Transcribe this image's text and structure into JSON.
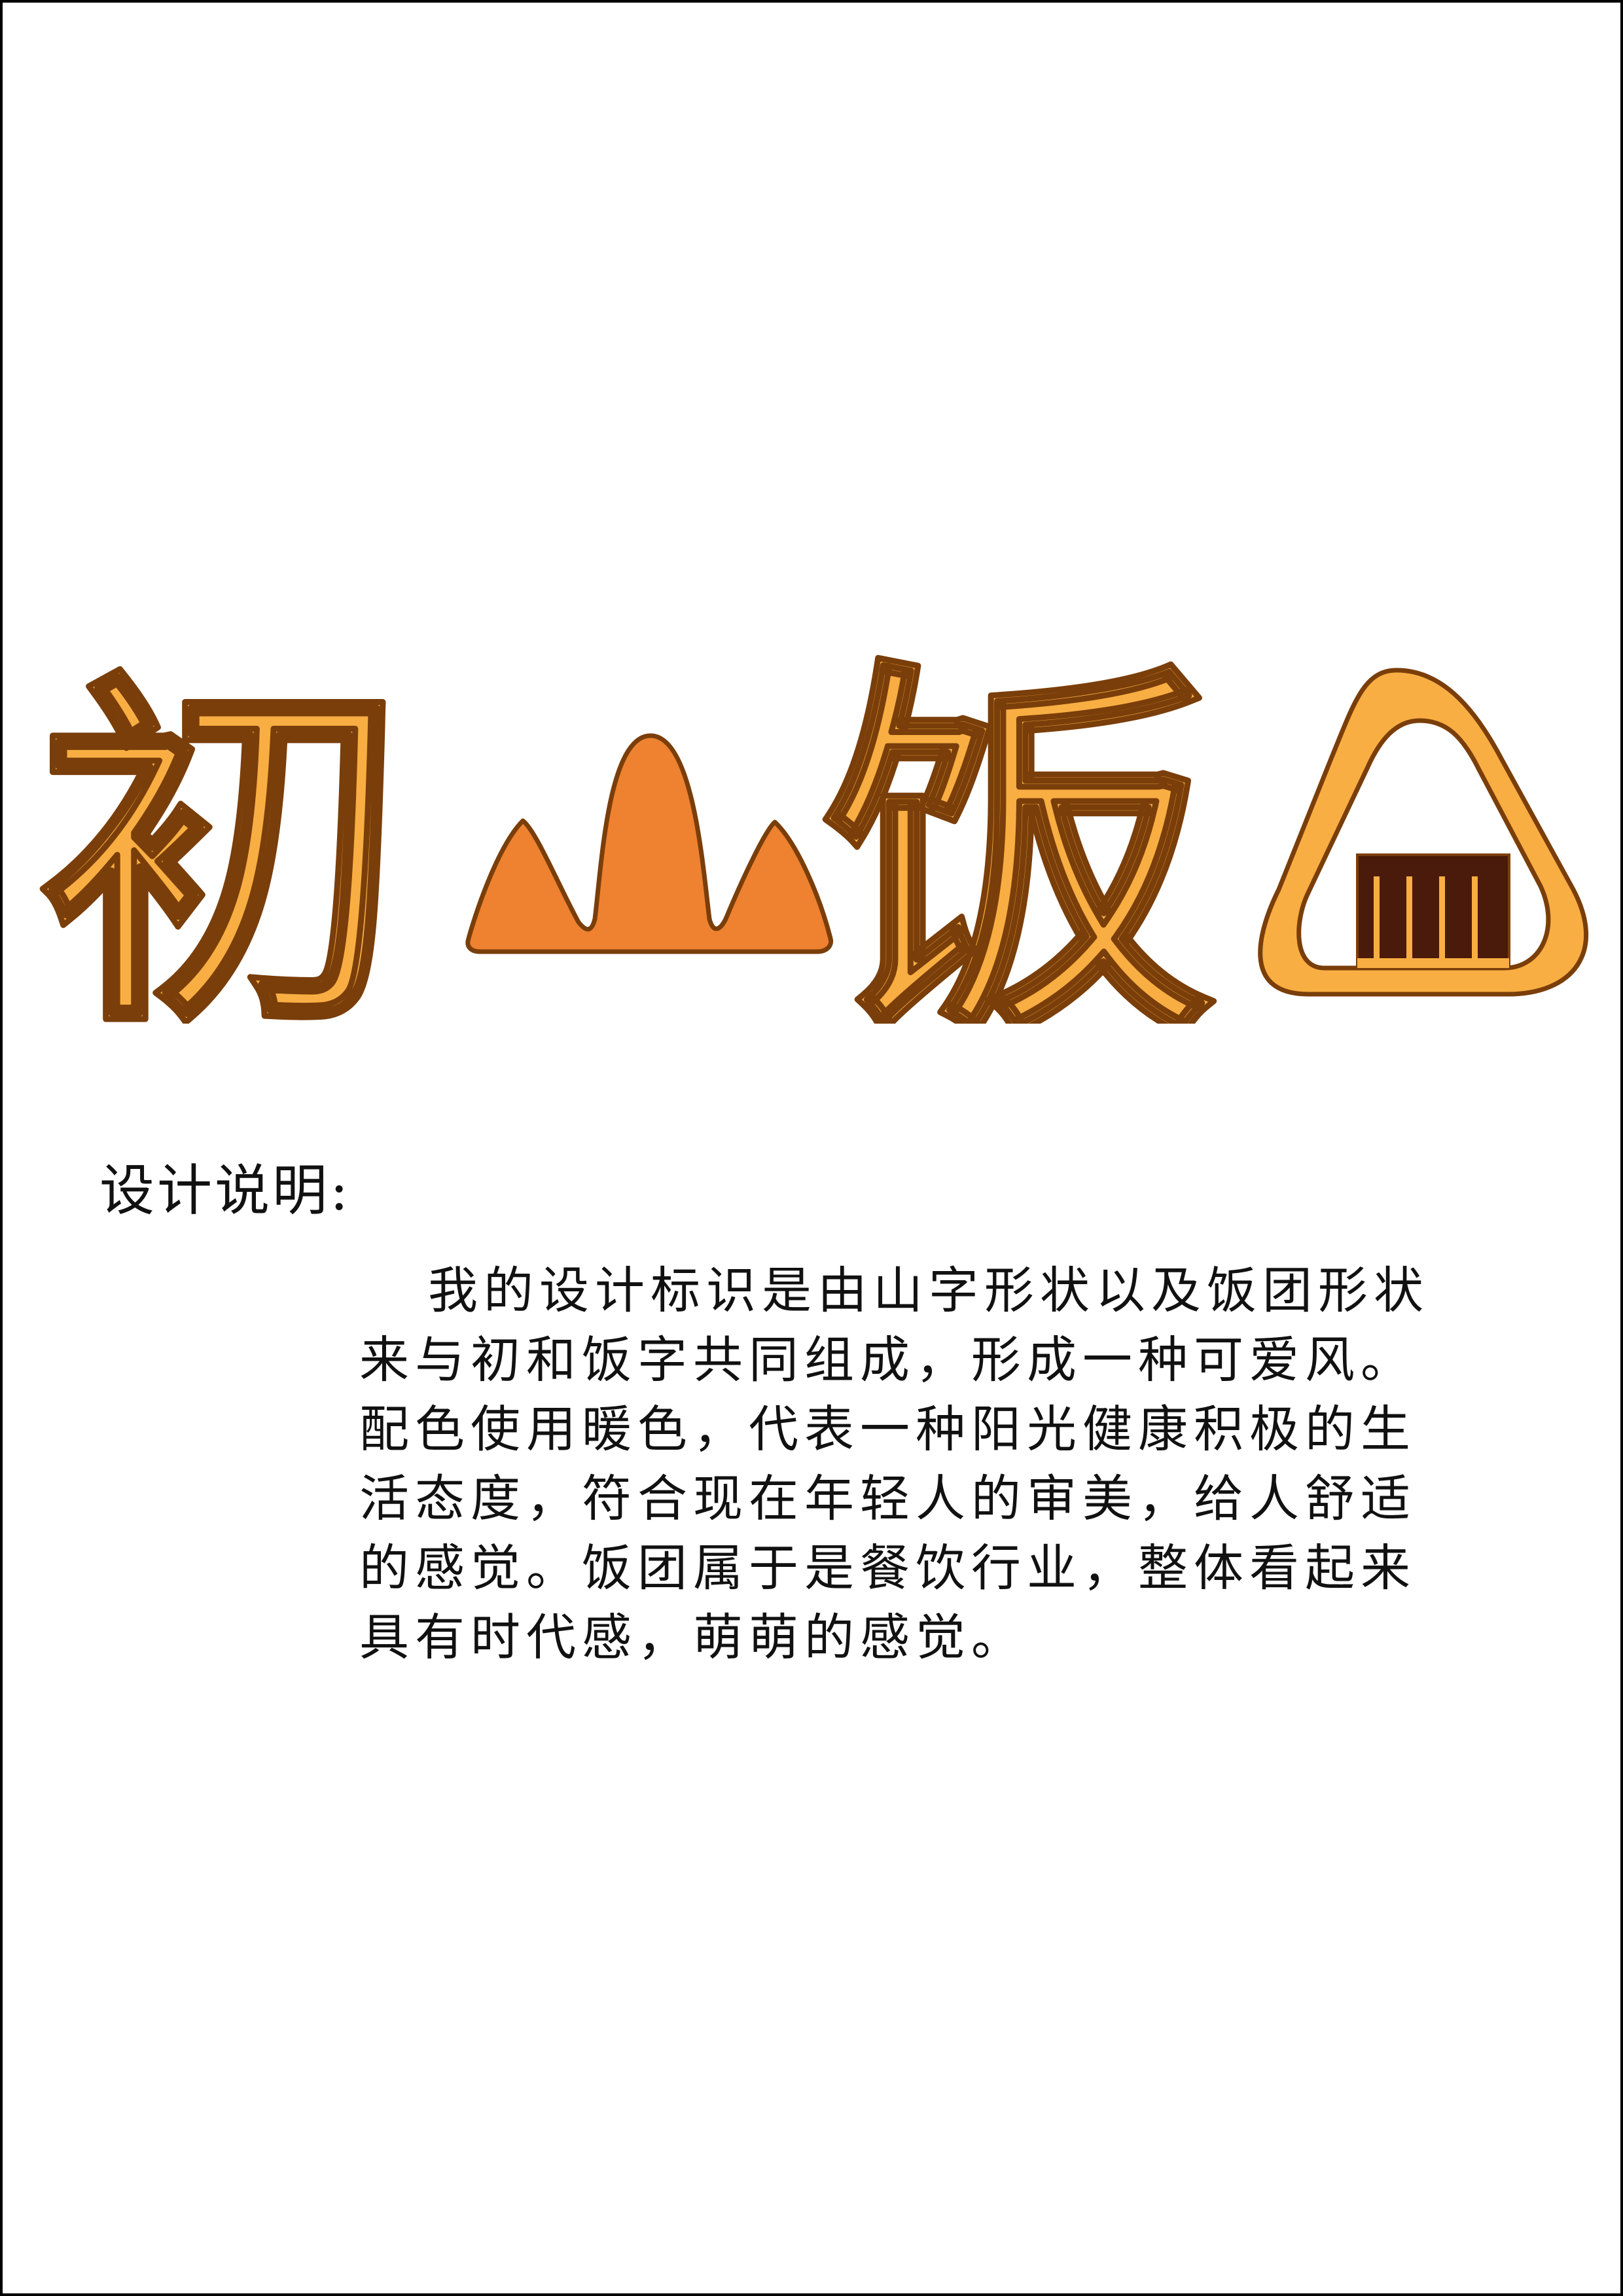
{
  "logo": {
    "char_1": "初",
    "char_2": "山",
    "char_3": "饭",
    "icon_name": "rice-ball-icon",
    "colors": {
      "letter_fill": "#F8AE42",
      "letter_stroke": "#7A3E0A",
      "mountain_fill": "#EE8230",
      "rice_ball_fill": "#F8AE42",
      "nori_fill": "#4A1A0A",
      "nori_stripes": "#F8AE42"
    }
  },
  "description": {
    "title": "设计说明:",
    "lines": [
      "我的设计标识是由山字形状以及饭团形状",
      "来与初和饭字共同组成，形成一种可爱风。",
      "配色使用暖色，代表一种阳光健康积极的生",
      "活态度，符合现在年轻人的审美，给人舒适",
      "的感觉。饭团属于是餐饮行业，整体看起来",
      "具有时代感，萌萌的感觉。"
    ]
  }
}
